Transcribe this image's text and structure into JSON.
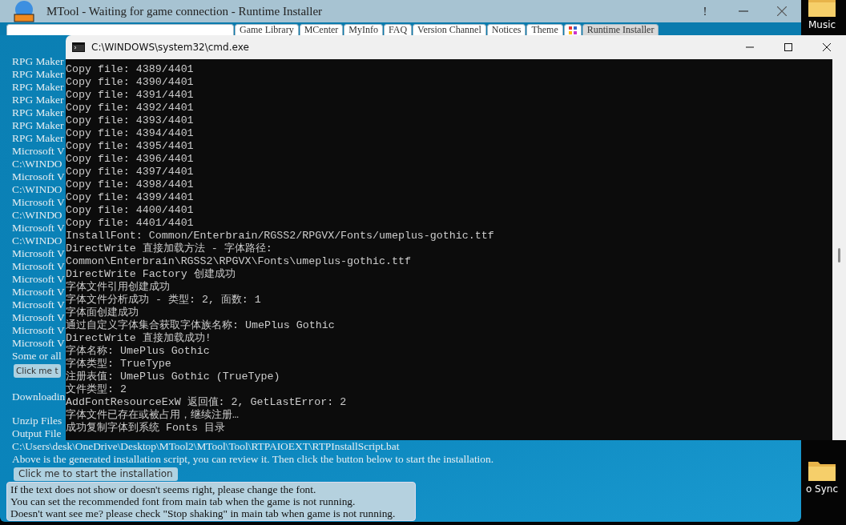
{
  "desktop": {
    "icons": [
      {
        "label": "Music"
      },
      {
        "label": "o Sync"
      }
    ]
  },
  "mtool": {
    "title": "MTool - Waiting for game connection - Runtime Installer",
    "alert_button": "!",
    "tabs": [
      {
        "kind": "blank",
        "selected": false
      },
      {
        "kind": "text",
        "label": "Game Library",
        "selected": false
      },
      {
        "kind": "text",
        "label": "MCenter",
        "selected": false
      },
      {
        "kind": "text",
        "label": "MyInfo",
        "selected": false
      },
      {
        "kind": "text",
        "label": "FAQ",
        "selected": false
      },
      {
        "kind": "text",
        "label": "Version Channel",
        "selected": false
      },
      {
        "kind": "text",
        "label": "Notices",
        "selected": false
      },
      {
        "kind": "text",
        "label": "Theme",
        "selected": false
      },
      {
        "kind": "icon",
        "selected": false
      },
      {
        "kind": "text",
        "label": "Runtime Installer",
        "selected": true
      }
    ],
    "content": [
      {
        "kind": "line",
        "text": "RPG Maker"
      },
      {
        "kind": "line",
        "text": "RPG Maker"
      },
      {
        "kind": "line",
        "text": "RPG Maker"
      },
      {
        "kind": "line",
        "text": "RPG Maker"
      },
      {
        "kind": "line",
        "text": "RPG Maker"
      },
      {
        "kind": "line",
        "text": "RPG Maker"
      },
      {
        "kind": "line",
        "text": "RPG Maker"
      },
      {
        "kind": "line",
        "text": "Microsoft V"
      },
      {
        "kind": "line",
        "text": "C:\\WINDO"
      },
      {
        "kind": "line",
        "text": "Microsoft V"
      },
      {
        "kind": "line",
        "text": "C:\\WINDO"
      },
      {
        "kind": "line",
        "text": "Microsoft V"
      },
      {
        "kind": "line",
        "text": "C:\\WINDO"
      },
      {
        "kind": "line",
        "text": "Microsoft V"
      },
      {
        "kind": "line",
        "text": "C:\\WINDO"
      },
      {
        "kind": "line",
        "text": "Microsoft V"
      },
      {
        "kind": "line",
        "text": "Microsoft V"
      },
      {
        "kind": "line",
        "text": "Microsoft V"
      },
      {
        "kind": "line",
        "text": "Microsoft V"
      },
      {
        "kind": "line",
        "text": "Microsoft V"
      },
      {
        "kind": "line",
        "text": "Microsoft V"
      },
      {
        "kind": "line",
        "text": "Microsoft V"
      },
      {
        "kind": "line",
        "text": "Microsoft V"
      },
      {
        "kind": "line",
        "text": "Some or all"
      },
      {
        "kind": "button",
        "text": "Click me t"
      },
      {
        "kind": "para",
        "text": "Downloadin"
      },
      {
        "kind": "para",
        "text": "Unzip Files"
      },
      {
        "kind": "line",
        "text": "Output File"
      },
      {
        "kind": "line",
        "text": "C:\\Users\\desk\\OneDrive\\Desktop\\MTool2\\MTool\\Tool\\RTPAIOEXT\\RTPInstallScript.bat"
      },
      {
        "kind": "line",
        "text": "Above is the generated installation script, you can review it. Then click the button below to start the installation."
      },
      {
        "kind": "button",
        "text": "Click me to start the installation"
      }
    ]
  },
  "tooltip": {
    "lines": [
      "If the text does not show or doesn't seems right, please change the font.",
      "You can set the recommended font from main tab when the game is not running.",
      "Doesn't want see me? please check \"Stop shaking\" in main tab when game is not running."
    ]
  },
  "cmd": {
    "title": "C:\\WINDOWS\\system32\\cmd.exe",
    "lines": [
      "Copy file: 4389/4401",
      "Copy file: 4390/4401",
      "Copy file: 4391/4401",
      "Copy file: 4392/4401",
      "Copy file: 4393/4401",
      "Copy file: 4394/4401",
      "Copy file: 4395/4401",
      "Copy file: 4396/4401",
      "Copy file: 4397/4401",
      "Copy file: 4398/4401",
      "Copy file: 4399/4401",
      "Copy file: 4400/4401",
      "Copy file: 4401/4401",
      "InstallFont: Common/Enterbrain/RGSS2/RPGVX/Fonts/umeplus-gothic.ttf",
      "DirectWrite 直接加载方法 - 字体路径:",
      "Common\\Enterbrain\\RGSS2\\RPGVX\\Fonts\\umeplus-gothic.ttf",
      "DirectWrite Factory 创建成功",
      "字体文件引用创建成功",
      "字体文件分析成功 - 类型: 2, 面数: 1",
      "字体面创建成功",
      "通过自定义字体集合获取字体族名称: UmePlus Gothic",
      "DirectWrite 直接加载成功!",
      "字体名称: UmePlus Gothic",
      "字体类型: TrueType",
      "注册表值: UmePlus Gothic (TrueType)",
      "文件类型: 2",
      "AddFontResourceExW 返回值: 2, GetLastError: 2",
      "字体文件已存在或被占用，继续注册…",
      "成功复制字体到系统 Fonts 目录"
    ]
  }
}
